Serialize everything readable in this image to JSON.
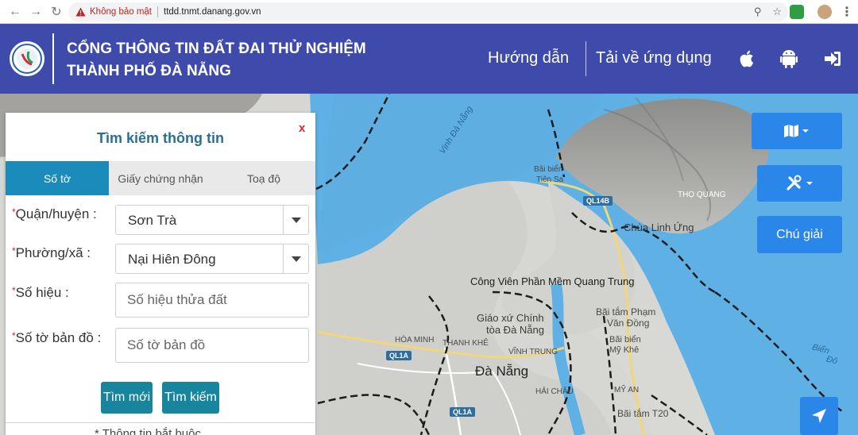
{
  "browser": {
    "security_label": "Không bảo mật",
    "url": "ttdd.tnmt.danang.gov.vn"
  },
  "header": {
    "title_line1": "CỔNG THÔNG TIN ĐẤT ĐAI THỬ NGHIỆM",
    "title_line2": "THÀNH PHỐ ĐÀ NẴNG",
    "nav_guide": "Hướng dẫn",
    "nav_download": "Tải về ứng dụng",
    "icons": [
      "apple-icon",
      "android-icon",
      "login-icon"
    ]
  },
  "colors": {
    "header_bg": "#3e4bab",
    "control_blue": "#2a86e8",
    "tab_active": "#1a8bbb",
    "button_teal": "#17859d",
    "panel_title": "#2a6f93",
    "required": "#e02020"
  },
  "search_panel": {
    "title": "Tìm kiếm thông tin",
    "close_label": "x",
    "tabs": [
      {
        "label": "Số tờ",
        "active": true
      },
      {
        "label": "Giấy chứng nhận",
        "active": false
      },
      {
        "label": "Toạ độ",
        "active": false
      }
    ],
    "fields": {
      "district_label": "Quận/huyện :",
      "district_value": "Sơn Trà",
      "ward_label": "Phường/xã :",
      "ward_value": "Nại Hiên Đông",
      "parcel_label": "Số hiệu :",
      "parcel_placeholder": "Số hiệu thửa đất",
      "sheet_label": "Số tờ bản đồ :",
      "sheet_placeholder": "Số tờ bản đồ"
    },
    "required_mark": "*",
    "reset_button": "Tìm mới",
    "search_button": "Tìm kiếm",
    "required_note": "* Thông tin bắt buộc"
  },
  "map_controls": {
    "legend_button": "Chú giải"
  },
  "map_labels": {
    "bay": "Vịnh Đà Nẵng",
    "tien_sa_1": "Bãi biển",
    "tien_sa_2": "Tiên Sa",
    "tho_quang": "THỌ QUANG",
    "chua_linh_ung": "Chùa Linh Ứng",
    "park": "Công Viên Phần Mềm Quang Trung",
    "church_1": "Giáo xứ Chính",
    "church_2": "tòa Đà Nẵng",
    "pham_van_dong_1": "Bãi tắm Phạm",
    "pham_van_dong_2": "Văn Đồng",
    "my_khe_1": "Bãi biển",
    "my_khe_2": "Mỹ Khê",
    "hoa_minh": "HÒA MINH",
    "thanh_khe": "THANH KHÊ",
    "vinh_trung": "VĨNH TRUNG",
    "da_nang": "Đà Nẵng",
    "hai_chau": "HẢI CHÂU",
    "my_an": "MỸ AN",
    "bai_tam_t20": "Bãi tắm T20",
    "bien_dong_1": "Biển",
    "bien_dong_2": "Đô",
    "road_ql14b": "QL14B",
    "road_ql1a_a": "QL1A",
    "road_ql1a_b": "QL1A"
  }
}
